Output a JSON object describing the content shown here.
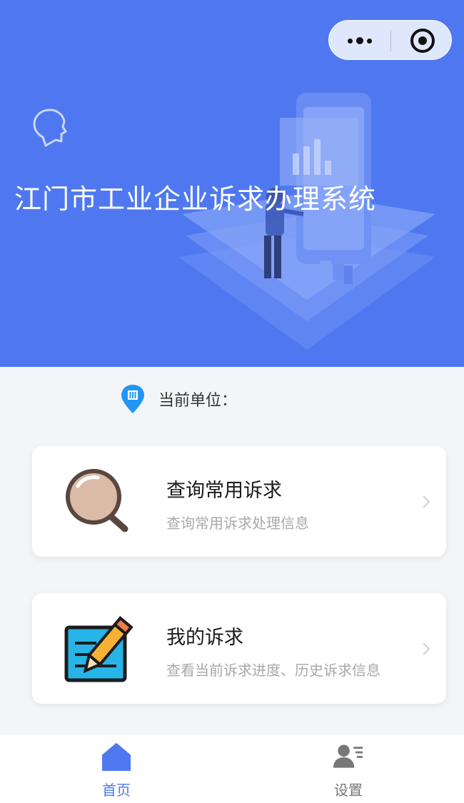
{
  "header": {
    "title": "江门市工业企业诉求办理系统",
    "background_color": "#4f78f0",
    "capsule_icons": [
      "more-dots-icon",
      "close-miniprogram-icon"
    ],
    "logo_icon": "head-silhouette-icon"
  },
  "unit": {
    "label": "当前单位：",
    "icon": "building-location-pin-icon",
    "value": ""
  },
  "cards": [
    {
      "title": "查询常用诉求",
      "subtitle": "查询常用诉求处理信息",
      "icon": "magnifier-icon"
    },
    {
      "title": "我的诉求",
      "subtitle": "查看当前诉求进度、历史诉求信息",
      "icon": "edit-pencil-icon"
    }
  ],
  "tabbar": {
    "items": [
      {
        "label": "首页",
        "icon": "home-icon",
        "active": true
      },
      {
        "label": "设置",
        "icon": "user-settings-icon",
        "active": false
      }
    ],
    "active_color": "#4f78f0",
    "inactive_color": "#777777"
  }
}
